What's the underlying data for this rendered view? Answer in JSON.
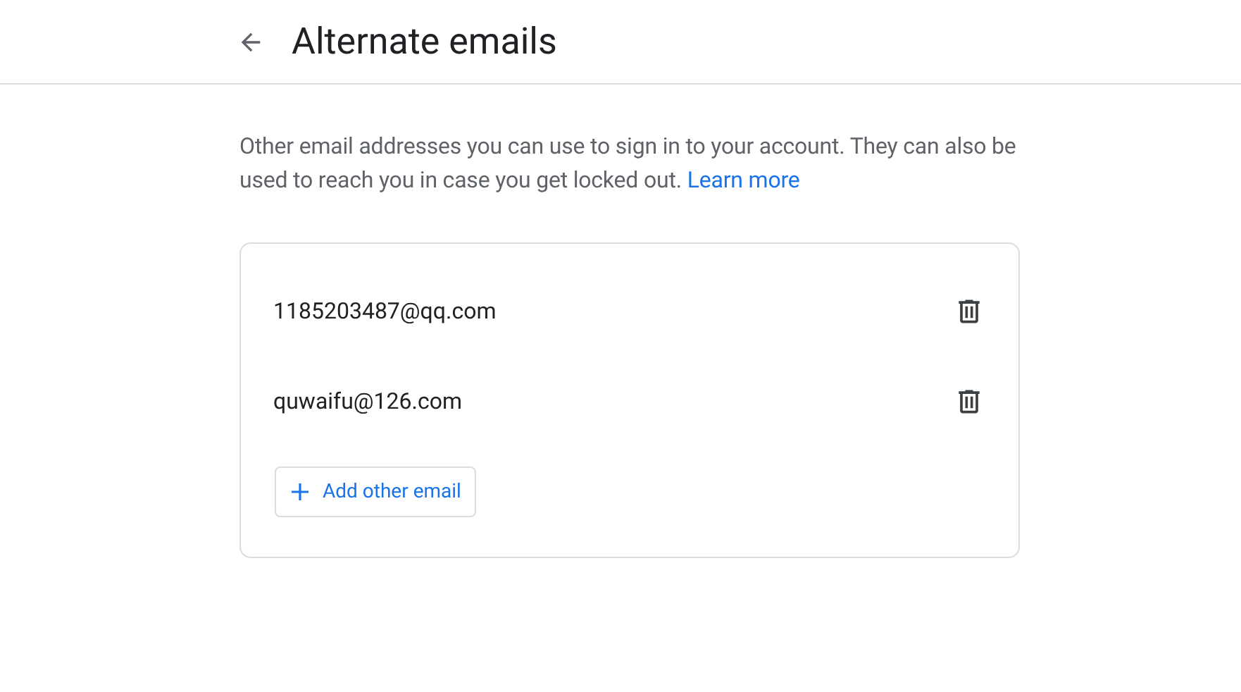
{
  "header": {
    "title": "Alternate emails"
  },
  "description": {
    "text": "Other email addresses you can use to sign in to your account. They can also be used to reach you in case you get locked out.",
    "link": "Learn more"
  },
  "emails": [
    {
      "address": "1185203487@qq.com"
    },
    {
      "address": "quwaifu@126.com"
    }
  ],
  "add_button": {
    "label": "Add other email"
  }
}
